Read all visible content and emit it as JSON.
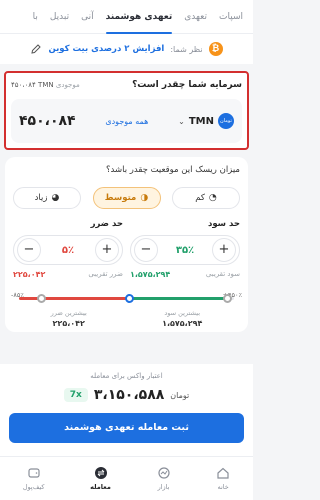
{
  "tabs": [
    {
      "label": "اسپات"
    },
    {
      "label": "تعهدی"
    },
    {
      "label": "تعهدی هوشمند"
    },
    {
      "label": "آنی"
    },
    {
      "label": "تبدیل"
    },
    {
      "label": "با"
    }
  ],
  "opinion": {
    "label": "نظر شما:",
    "value": "افزایش ۲ درصدی بیت کوین",
    "coin_symbol": "₿"
  },
  "invest": {
    "question": "سرمایه شما چقدر است؟",
    "balance_label": "موجودی",
    "balance_value": "۴۵۰،۰۸۴ TMN",
    "currency_code": "TMN",
    "currency_icon_text": "تومان",
    "all_label": "همه موجودی",
    "amount": "۴۵۰،۰۸۴"
  },
  "risk": {
    "title": "میزان ریسک این موقعیت چقدر باشد؟",
    "options": [
      {
        "label": "کم"
      },
      {
        "label": "متوسط"
      },
      {
        "label": "زیاد"
      }
    ],
    "selected": "متوسط"
  },
  "take_profit": {
    "title": "حد سود",
    "percent": "۳۵٪",
    "approx_label": "سود تقریبی",
    "approx_value": "۱،۵۷۵،۲۹۴",
    "max_label": "بیشترین سود",
    "max_value": "۱،۵۷۵،۲۹۴"
  },
  "stop_loss": {
    "title": "حد ضرر",
    "percent": "۵٪",
    "approx_label": "ضرر تقریبی",
    "approx_value": "۲۲۵،۰۴۲",
    "max_label": "بیشترین ضرر",
    "max_value": "۲۲۵،۰۴۲"
  },
  "slider": {
    "left_end": "-۸۵٪",
    "right_end": "+۴۵۰٪"
  },
  "leverage": {
    "label": "اعتبار واکس برای معامله",
    "total": "۳،۱۵۰،۵۸۸",
    "unit": "تومان",
    "badge": "7x"
  },
  "submit_label": "ثبت معامله تعهدی هوشمند",
  "nav": [
    {
      "label": "خانه"
    },
    {
      "label": "بازار"
    },
    {
      "label": "معامله"
    },
    {
      "label": "کیف‌پول"
    }
  ],
  "colors": {
    "accent": "#1d6fe0",
    "profit": "#22a06b",
    "loss": "#e0483f",
    "highlight_border": "#d32f2f"
  }
}
